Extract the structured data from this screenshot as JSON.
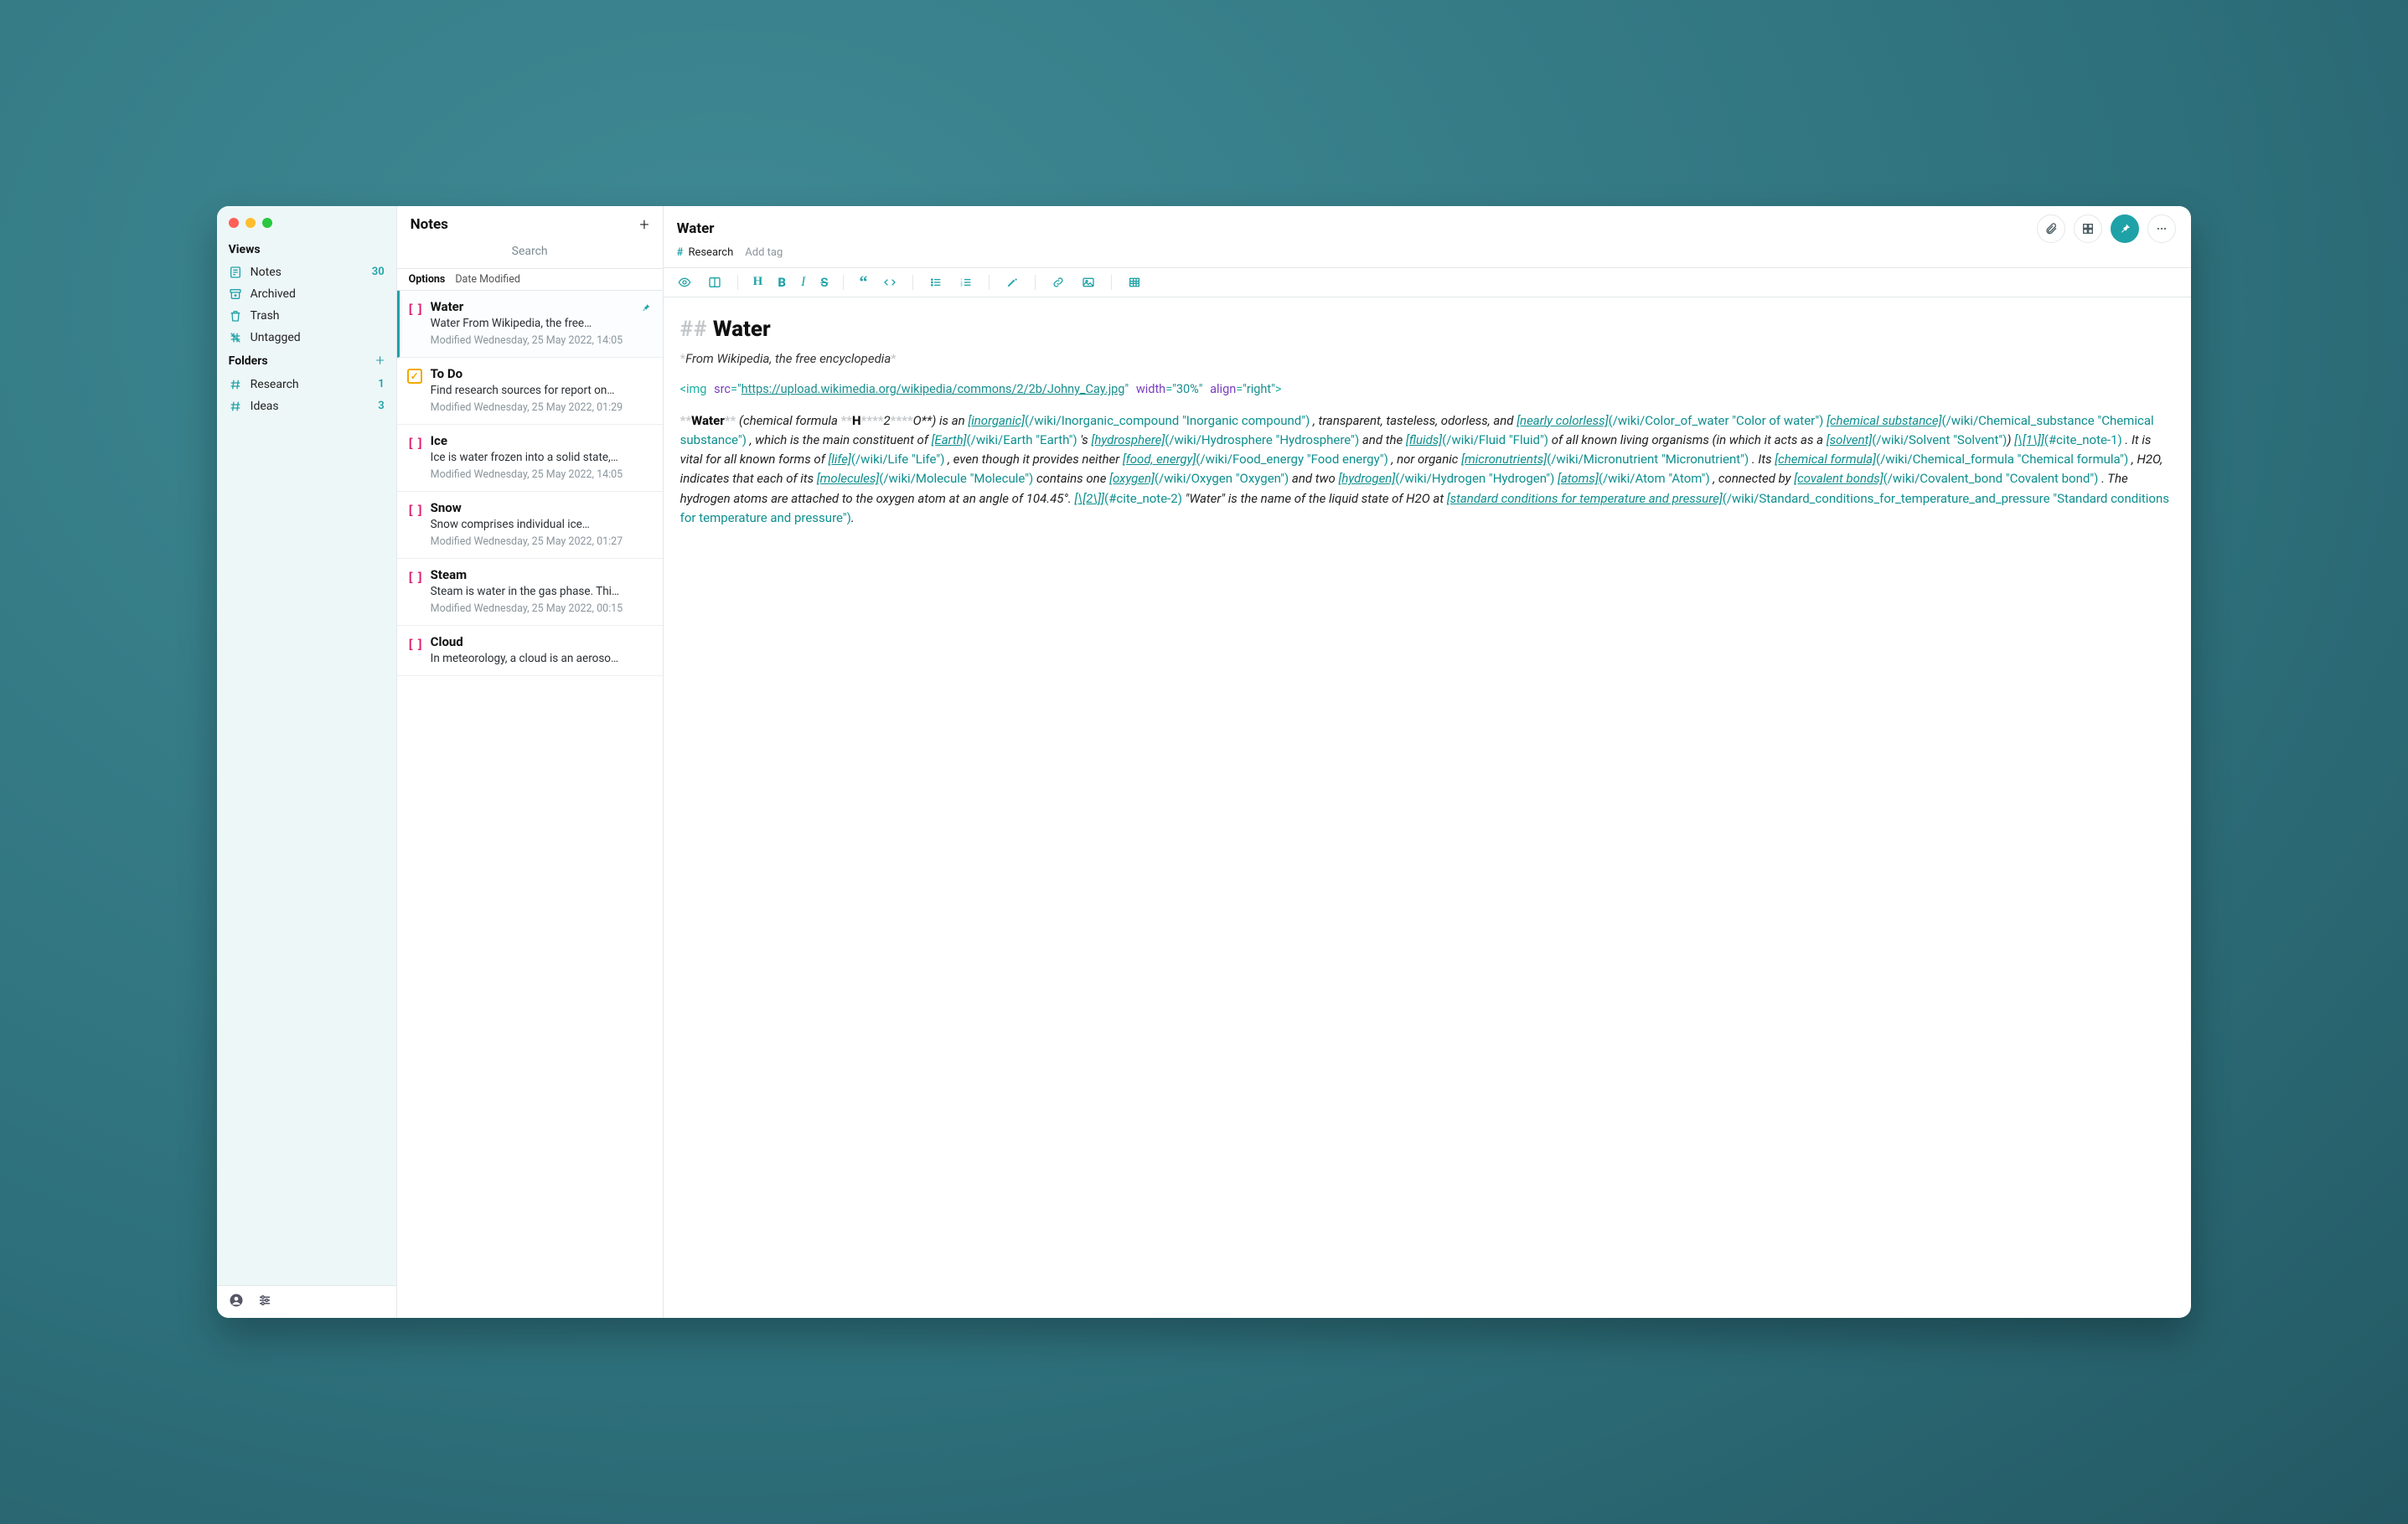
{
  "sidebar": {
    "views_heading": "Views",
    "folders_heading": "Folders",
    "views": [
      {
        "id": "notes",
        "label": "Notes",
        "count": "30"
      },
      {
        "id": "archived",
        "label": "Archived",
        "count": ""
      },
      {
        "id": "trash",
        "label": "Trash",
        "count": ""
      },
      {
        "id": "untagged",
        "label": "Untagged",
        "count": ""
      }
    ],
    "folders": [
      {
        "id": "research",
        "label": "Research",
        "count": "1"
      },
      {
        "id": "ideas",
        "label": "Ideas",
        "count": "3"
      }
    ]
  },
  "list": {
    "heading": "Notes",
    "search_placeholder": "Search",
    "options_label": "Options",
    "sort_label": "Date Modified",
    "items": [
      {
        "icon": "brackets",
        "title": "Water",
        "preview": "Water From Wikipedia, the free…",
        "meta": "Modified Wednesday, 25 May 2022, 14:05",
        "pinned": true,
        "selected": true
      },
      {
        "icon": "todo",
        "title": "To Do",
        "preview": "Find research sources for report on…",
        "meta": "Modified Wednesday, 25 May 2022, 01:29"
      },
      {
        "icon": "brackets",
        "title": "Ice",
        "preview": "Ice is water frozen into a solid state,…",
        "meta": "Modified Wednesday, 25 May 2022, 14:05"
      },
      {
        "icon": "brackets",
        "title": "Snow",
        "preview": "Snow comprises individual ice…",
        "meta": "Modified Wednesday, 25 May 2022, 01:27"
      },
      {
        "icon": "brackets",
        "title": "Steam",
        "preview": "Steam is water in the gas phase. Thi…",
        "meta": "Modified Wednesday, 25 May 2022, 00:15"
      },
      {
        "icon": "brackets",
        "title": "Cloud",
        "preview": "In meteorology, a cloud is an aeroso…",
        "meta": ""
      }
    ]
  },
  "editor": {
    "title": "Water",
    "tag": "Research",
    "add_tag": "Add tag",
    "doc": {
      "heading_markers": "##",
      "heading": "Water",
      "subtitle": "From Wikipedia, the free encyclopedia",
      "img_open": "<img",
      "img_src_attr": "src",
      "img_src_val": "https://upload.wikimedia.org/wikipedia/commons/2/2b/Johny_Cay.jpg",
      "img_width_attr": "width",
      "img_width_val": "30%",
      "img_align_attr": "align",
      "img_align_val": "right",
      "img_close": ">",
      "p_water": "Water",
      "p_chemformula": " (chemical formula ",
      "p_H": "H",
      "p_stars2O": "2",
      "p_O": "O**) is an ",
      "l_inorganic": "[inorganic]",
      "w_inorganic": "(/wiki/Inorganic_compound \"Inorganic compound\")",
      "p_tto": ", transparent, tasteless, odorless, and ",
      "l_nearlycolorless": "[nearly colorless]",
      "w_nearlycolorless": "(/wiki/Color_of_water \"Color of water\")",
      "sp1": " ",
      "l_chemsub": "[chemical substance]",
      "w_chemsub": "(/wiki/Chemical_substance \"Chemical substance\")",
      "p_mainconst": ", which is the main constituent of ",
      "l_earth": "[Earth]",
      "w_earth": "(/wiki/Earth \"Earth\")",
      "p_s": "'s ",
      "l_hydro": "[hydrosphere]",
      "w_hydro": "(/wiki/Hydrosphere \"Hydrosphere\")",
      "p_andthe": " and the ",
      "l_fluids": "[fluids]",
      "w_fluids": "(/wiki/Fluid \"Fluid\")",
      "p_known": " of all known living organisms (in which it acts as a ",
      "l_solvent": "[solvent]",
      "w_solvent": "(/wiki/Solvent \"Solvent\")",
      "p_paren": ")",
      "l_cite1a": "[\\[1\\]]",
      "w_cite1": "(#cite_note-1)",
      "p_vital": ". It is vital for all known forms of ",
      "l_life": "[life]",
      "w_life": "(/wiki/Life \"Life\")",
      "p_eventhough": ", even though it provides neither ",
      "l_food": "[food, energy]",
      "w_food": "(/wiki/Food_energy \"Food energy\")",
      "p_nororg": ", nor organic ",
      "l_micro": "[micronutrients]",
      "w_micro": "(/wiki/Micronutrient \"Micronutrient\")",
      "p_its": ". Its ",
      "l_chemform": "[chemical formula]",
      "w_chemform": "(/wiki/Chemical_formula \"Chemical formula\")",
      "p_h2oind": ", H2O, indicates that each of its ",
      "l_molec": "[molecules]",
      "w_molec": "(/wiki/Molecule \"Molecule\")",
      "p_containsone": " contains one ",
      "l_oxy": "[oxygen]",
      "w_oxy": "(/wiki/Oxygen \"Oxygen\")",
      "p_andtwo": " and two ",
      "l_hydr": "[hydrogen]",
      "w_hydr": "(/wiki/Hydrogen \"Hydrogen\")",
      "sp2": " ",
      "l_atoms": "[atoms]",
      "w_atoms": "(/wiki/Atom \"Atom\")",
      "p_connby": ", connected by ",
      "l_covalent": "[covalent bonds]",
      "w_covalent": "(/wiki/Covalent_bond \"Covalent bond\")",
      "p_hydrogenatoms": ". The hydrogen atoms are attached to the oxygen atom at an angle of 104.45°.",
      "l_cite2a": "[\\[2\\]]",
      "w_cite2": "(#cite_note-2)",
      "p_waterisname": " \"Water\" is the name of the liquid state of H2O at ",
      "l_stp": "[standard conditions for temperature and pressure]",
      "w_stp": "(/wiki/Standard_conditions_for_temperature_and_pressure \"Standard conditions for temperature and pressure\")",
      "p_period": "."
    }
  }
}
